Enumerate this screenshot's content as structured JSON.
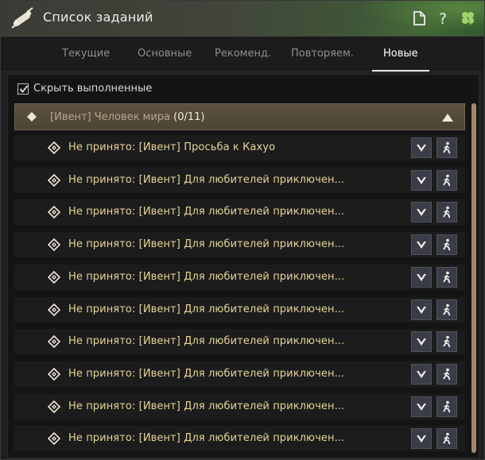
{
  "window": {
    "title": "Список заданий"
  },
  "tabs": [
    {
      "label": "Текущие"
    },
    {
      "label": "Основные"
    },
    {
      "label": "Рекоменд."
    },
    {
      "label": "Повторяем."
    },
    {
      "label": "Новые",
      "active": true
    }
  ],
  "filter": {
    "hide_completed_label": "Скрыть выполненные",
    "hide_completed_checked": true
  },
  "category": {
    "title": "[Ивент] Человек мира",
    "count": "(0/11)",
    "expanded": true
  },
  "quests": [
    {
      "text": "Не принято: [Ивент] Просьба к Кахуо"
    },
    {
      "text": "Не принято: [Ивент] Для любителей приключен..."
    },
    {
      "text": "Не принято: [Ивент] Для любителей приключен..."
    },
    {
      "text": "Не принято: [Ивент] Для любителей приключен..."
    },
    {
      "text": "Не принято: [Ивент] Для любителей приключен..."
    },
    {
      "text": "Не принято: [Ивент] Для любителей приключен..."
    },
    {
      "text": "Не принято: [Ивент] Для любителей приключен..."
    },
    {
      "text": "Не принято: [Ивент] Для любителей приключен..."
    },
    {
      "text": "Не принято: [Ивент] Для любителей приключен..."
    },
    {
      "text": "Не принято: [Ивент] Для любителей приключен..."
    }
  ],
  "icons": {
    "title": "scroll-icon",
    "toolbar": [
      "document-icon",
      "help-icon",
      "clover-icon"
    ],
    "category": "diamond-icon",
    "quest": "quest-marker-icon",
    "row_buttons": [
      "chevron-down-icon",
      "walking-person-icon"
    ]
  },
  "colors": {
    "quest_text": "#e6d594",
    "category_bg": "#5c5142",
    "accent_green": "#3f5638"
  }
}
